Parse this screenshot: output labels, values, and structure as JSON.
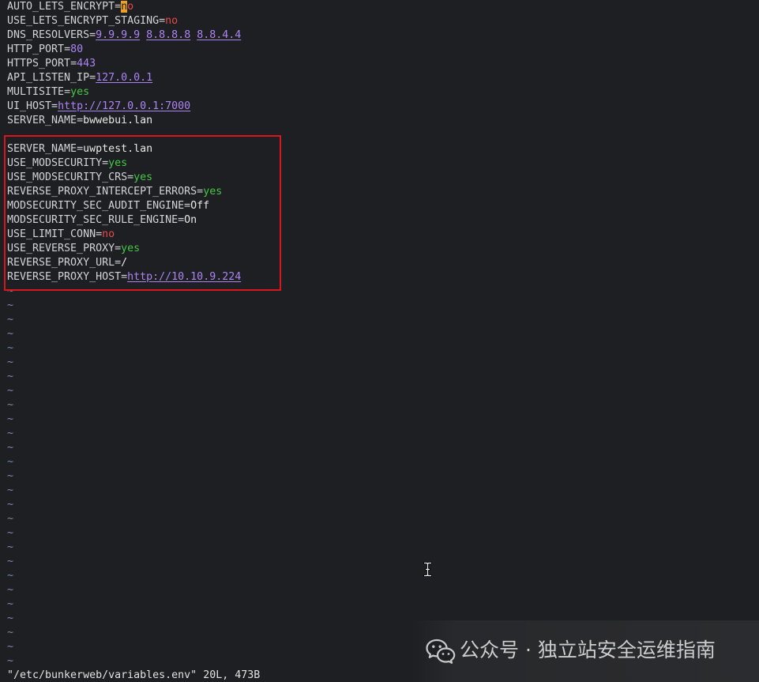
{
  "editor": {
    "separator": "=",
    "global_settings": [
      {
        "key": "AUTO_LETS_ENCRYPT",
        "value": "no"
      },
      {
        "key": "USE_LETS_ENCRYPT_STAGING",
        "value": "no"
      },
      {
        "key": "DNS_RESOLVERS",
        "value": [
          "9.9.9.9",
          "8.8.8.8",
          "8.8.4.4"
        ]
      },
      {
        "key": "HTTP_PORT",
        "value": "80"
      },
      {
        "key": "HTTPS_PORT",
        "value": "443"
      },
      {
        "key": "API_LISTEN_IP",
        "value": "127.0.0.1"
      },
      {
        "key": "MULTISITE",
        "value": "yes"
      },
      {
        "key": "UI_HOST",
        "value": "http://127.0.0.1:7000"
      },
      {
        "key": "SERVER_NAME",
        "value": "bwwebui.lan"
      }
    ],
    "site_settings": [
      {
        "key": "SERVER_NAME",
        "value": "uwptest.lan"
      },
      {
        "key": "USE_MODSECURITY",
        "value": "yes"
      },
      {
        "key": "USE_MODSECURITY_CRS",
        "value": "yes"
      },
      {
        "key": "REVERSE_PROXY_INTERCEPT_ERRORS",
        "value": "yes"
      },
      {
        "key": "MODSECURITY_SEC_AUDIT_ENGINE",
        "value": "Off"
      },
      {
        "key": "MODSECURITY_SEC_RULE_ENGINE",
        "value": "On"
      },
      {
        "key": "USE_LIMIT_CONN",
        "value": "no"
      },
      {
        "key": "USE_REVERSE_PROXY",
        "value": "yes"
      },
      {
        "key": "REVERSE_PROXY_URL",
        "value": "/"
      },
      {
        "key": "REVERSE_PROXY_HOST",
        "value": "http://10.10.9.224"
      }
    ],
    "empty_line_marker": "~"
  },
  "status_line": {
    "filename": "\"/etc/bunkerweb/variables.env\"",
    "file_info": "20L, 473B"
  },
  "watermark": {
    "icon": "wechat-icon",
    "text": "公众号 · 独立站安全运维指南"
  },
  "mouse_pointer": {
    "icon": "text-cursor-icon"
  },
  "colors": {
    "background": "#1e1f22",
    "key": "#d1d3d6",
    "plain_value": "#e8e8e8",
    "number": "#ac84f2",
    "false_value": "#e5484d",
    "true_value": "#45c845",
    "empty_line_marker": "#7d8ab8",
    "cursor": "#f0a020",
    "highlight_box": "#d9161e",
    "status_text": "#e2e2e2",
    "watermark_text": "#cccccc"
  }
}
